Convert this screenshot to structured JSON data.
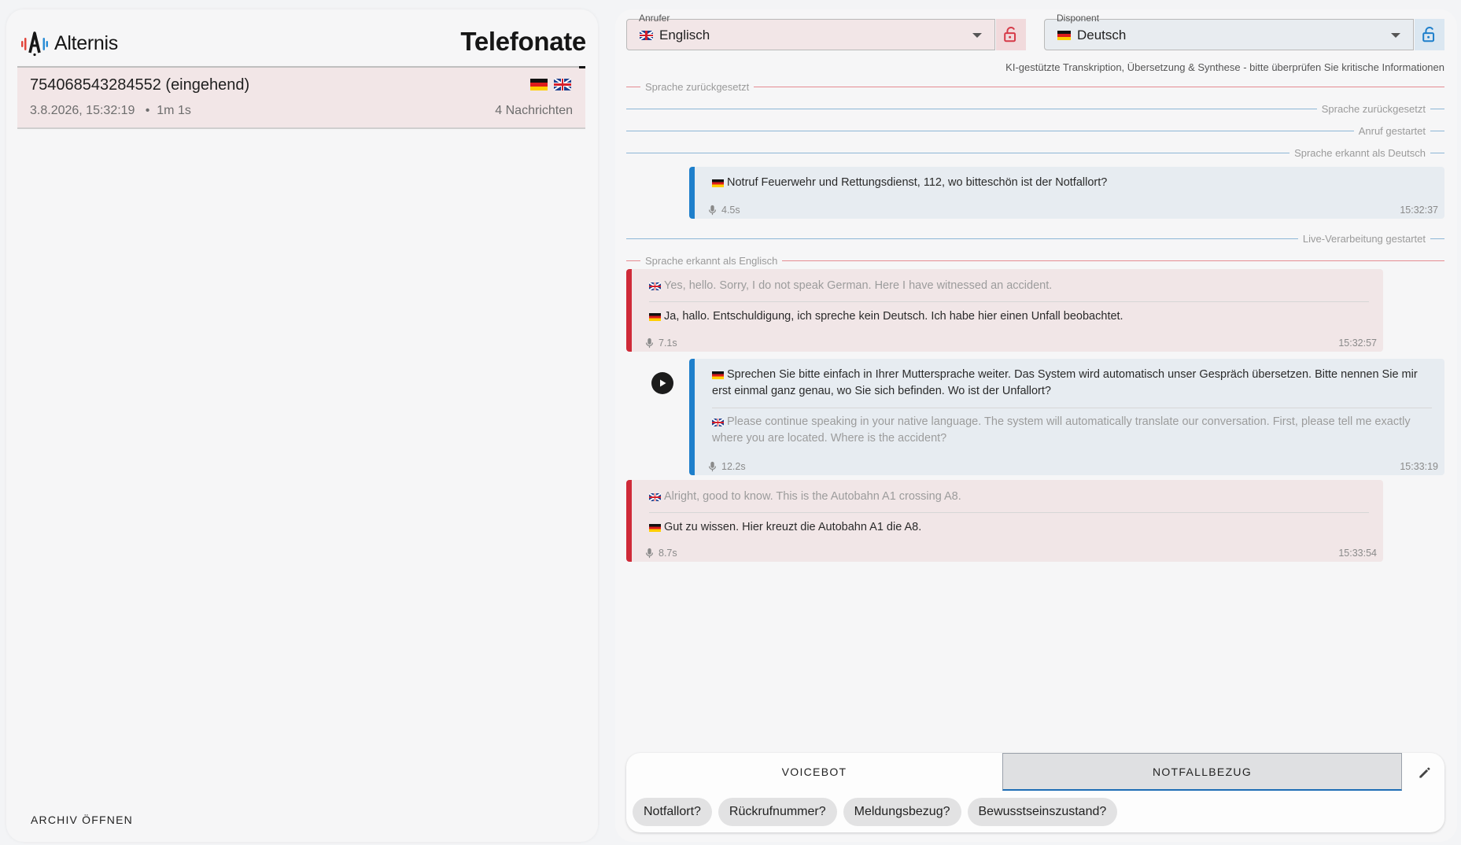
{
  "brand": {
    "name": "Alternis"
  },
  "left": {
    "title": "Telefonate",
    "call": {
      "title": "754068543284552 (eingehend)",
      "meta": "3.8.2026, 15:32:19   •  1m 1s",
      "count": "4 Nachrichten"
    },
    "archive_label": "ARCHIV ÖFFNEN"
  },
  "right": {
    "caller_legend": "Anrufer",
    "caller_language": "Englisch",
    "dispatcher_legend": "Disponent",
    "dispatcher_language": "Deutsch",
    "disclaimer": "KI-gestützte Transkription, Übersetzung & Synthese - bitte überprüfen Sie kritische Informationen",
    "events": {
      "reset_caller": "Sprache zurückgesetzt",
      "reset_dispatcher": "Sprache zurückgesetzt",
      "call_started": "Anruf gestartet",
      "detected_de": "Sprache erkannt als Deutsch",
      "live_started": "Live-Verarbeitung gestartet",
      "detected_en": "Sprache erkannt als Englisch"
    },
    "messages": [
      {
        "text": "Notruf Feuerwehr und Rettungsdienst, 112, wo bitteschön ist der Notfallort?",
        "duration": "4.5s",
        "time": "15:32:37"
      },
      {
        "original": "Yes, hello. Sorry, I do not speak German. Here I have witnessed an accident.",
        "translation": "Ja, hallo. Entschuldigung, ich spreche kein Deutsch. Ich habe hier einen Unfall beobachtet.",
        "duration": "7.1s",
        "time": "15:32:57"
      },
      {
        "text_line1": "Sprechen Sie bitte einfach in Ihrer Muttersprache weiter. Das System wird automatisch unser Gespräch übersetzen. Bitte nennen Sie mir",
        "text_line2": "erst einmal ganz genau, wo Sie sich befinden. Wo ist der Unfallort?",
        "translation_line1": "Please continue speaking in your native language. The system will automatically translate our conversation. First, please tell me exactly",
        "translation_line2": "where you are located. Where is the accident?",
        "duration": "12.2s",
        "time": "15:33:19"
      },
      {
        "original": "Alright, good to know. This is the Autobahn A1 crossing A8.",
        "translation": "Gut zu wissen. Hier kreuzt die Autobahn A1 die A8.",
        "duration": "8.7s",
        "time": "15:33:54"
      }
    ],
    "tabs": {
      "voicebot": "VOICEBOT",
      "notfall": "NOTFALLBEZUG"
    },
    "chips": [
      "Notfallort?",
      "Rückrufnummer?",
      "Meldungsbezug?",
      "Bewusstseinszustand?"
    ]
  },
  "colors": {
    "caller_accent": "#cf2a38",
    "dispatcher_accent": "#1e7fcb",
    "caller_bg": "#f1e6e7",
    "dispatcher_bg": "#e7ecf1"
  }
}
